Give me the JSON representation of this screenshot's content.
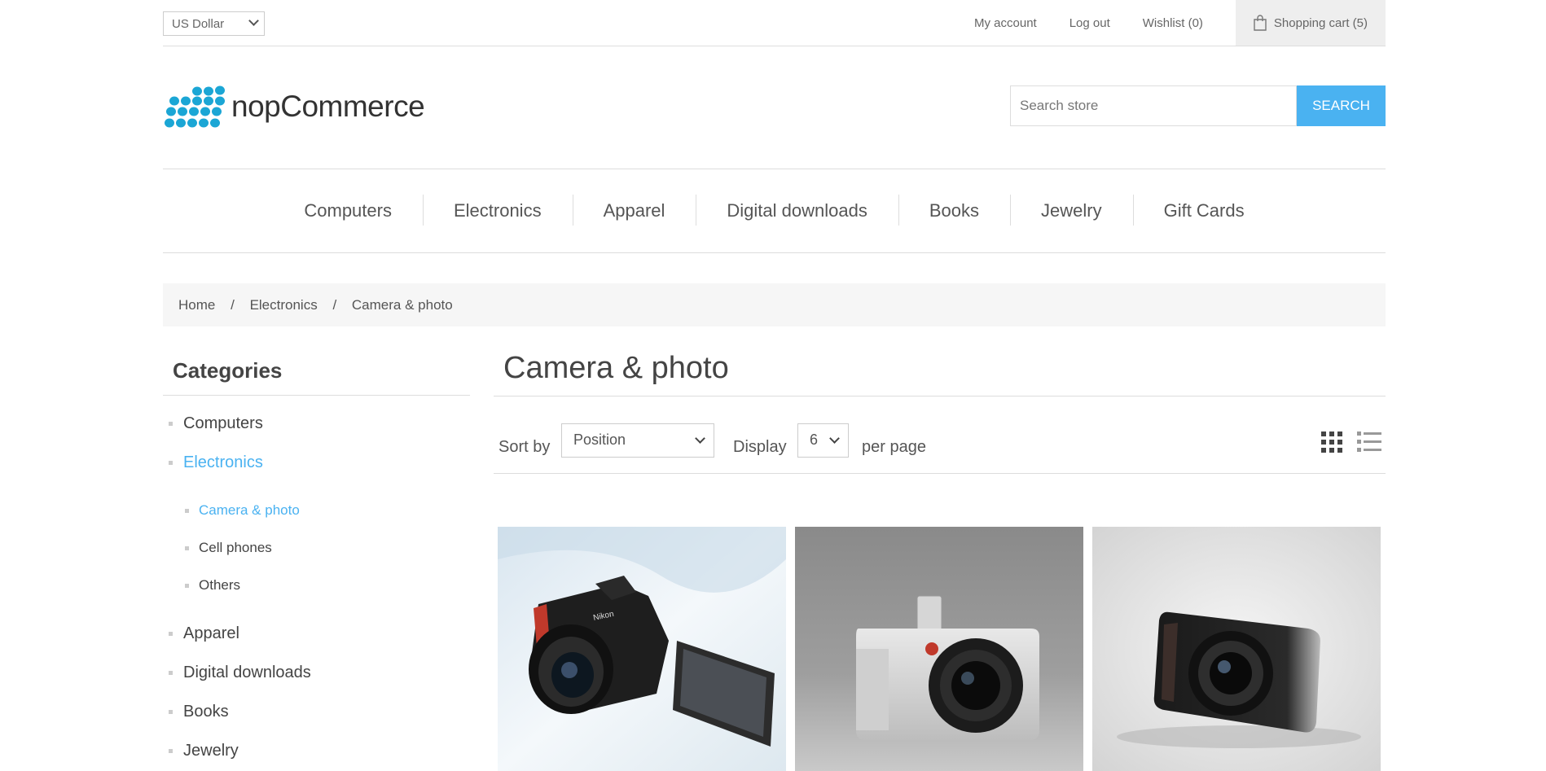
{
  "header": {
    "currency": "US Dollar",
    "links": [
      "My account",
      "Log out",
      "Wishlist (0)"
    ],
    "cart": "Shopping cart (5)",
    "logo_text": "nopCommerce",
    "search_placeholder": "Search store",
    "search_button": "Search"
  },
  "menu": [
    "Computers",
    "Electronics",
    "Apparel",
    "Digital downloads",
    "Books",
    "Jewelry",
    "Gift Cards"
  ],
  "breadcrumb": {
    "home": "Home",
    "sep": "/",
    "parent": "Electronics",
    "current": "Camera & photo"
  },
  "sidebar": {
    "title": "Categories",
    "items": [
      "Computers",
      "Electronics"
    ],
    "subitems": [
      "Camera & photo",
      "Cell phones",
      "Others"
    ],
    "items_after": [
      "Apparel",
      "Digital downloads",
      "Books",
      "Jewelry"
    ]
  },
  "main": {
    "title": "Camera & photo",
    "sort_label": "Sort by",
    "sort_value": "Position",
    "display_label": "Display",
    "display_value": "6",
    "per_page": "per page"
  },
  "products": [
    "nikon-dslr-camera",
    "leica-mirrorless-camera",
    "apple-style-compact-camera"
  ],
  "colors": {
    "accent": "#4ab2f1",
    "logo": "#1ba6d5"
  }
}
